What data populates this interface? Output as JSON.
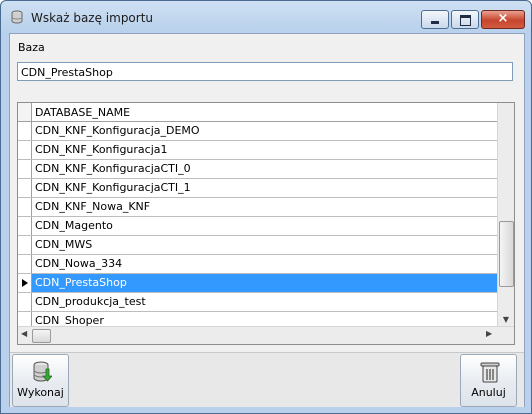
{
  "window": {
    "title": "Wskaż bazę importu",
    "caption_min": "minimize",
    "caption_max": "maximize",
    "caption_close": "×"
  },
  "form": {
    "label": "Baza",
    "value": "CDN_PrestaShop"
  },
  "grid": {
    "column_header": "DATABASE_NAME",
    "rows": [
      {
        "name": "CDN_KNF_Konfiguracja_DEMO",
        "selected": false
      },
      {
        "name": "CDN_KNF_Konfiguracja1",
        "selected": false
      },
      {
        "name": "CDN_KNF_KonfiguracjaCTI_0",
        "selected": false
      },
      {
        "name": "CDN_KNF_KonfiguracjaCTI_1",
        "selected": false
      },
      {
        "name": "CDN_KNF_Nowa_KNF",
        "selected": false
      },
      {
        "name": "CDN_Magento",
        "selected": false
      },
      {
        "name": "CDN_MWS",
        "selected": false
      },
      {
        "name": "CDN_Nowa_334",
        "selected": false
      },
      {
        "name": "CDN_PrestaShop",
        "selected": true
      },
      {
        "name": "CDN_produkcja_test",
        "selected": false
      },
      {
        "name": "CDN_Shoper",
        "selected": false
      }
    ],
    "selection_color": "#3399ff"
  },
  "buttons": {
    "execute": {
      "label": "Wykonaj",
      "icon": "database-import-icon"
    },
    "cancel": {
      "label": "Anuluj",
      "icon": "trash-icon"
    }
  }
}
